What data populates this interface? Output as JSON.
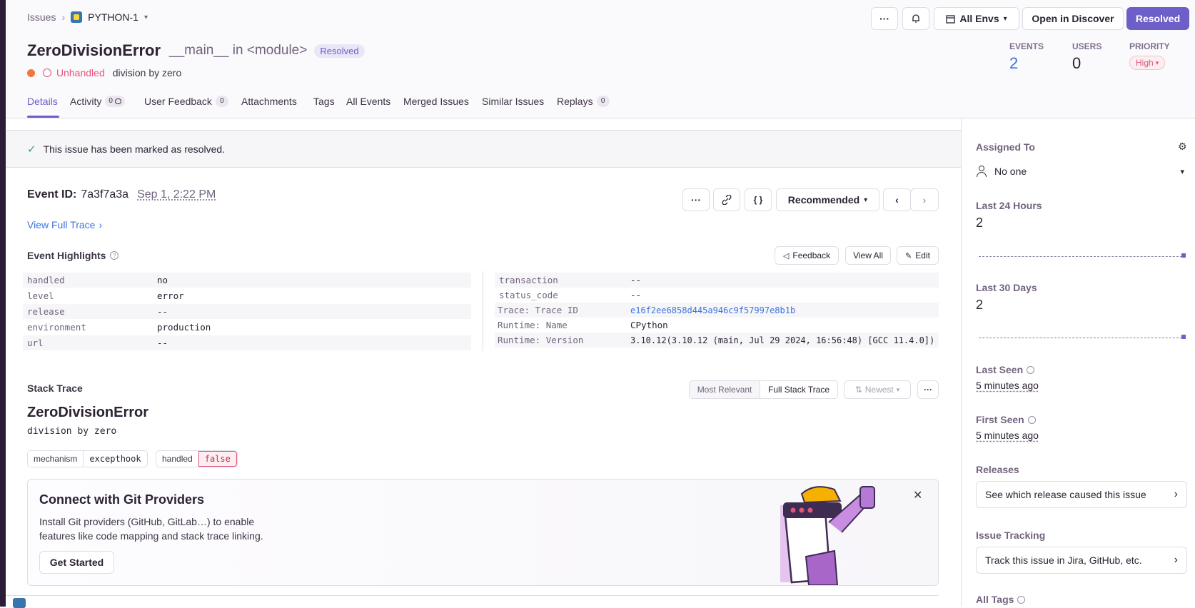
{
  "breadcrumb": {
    "issues": "Issues",
    "project": "PYTHON-1"
  },
  "header_buttons": {
    "env": "All Envs",
    "discover": "Open in Discover",
    "resolved": "Resolved"
  },
  "issue": {
    "title": "ZeroDivisionError",
    "culprit": "__main__ in <module>",
    "status_badge": "Resolved",
    "unhandled": "Unhandled",
    "message": "division by zero"
  },
  "stats": {
    "events_label": "EVENTS",
    "events": "2",
    "users_label": "USERS",
    "users": "0",
    "priority_label": "PRIORITY",
    "priority": "High"
  },
  "tabs": [
    {
      "label": "Details"
    },
    {
      "label": "Activity",
      "count": "0"
    },
    {
      "label": "User Feedback",
      "count": "0"
    },
    {
      "label": "Attachments"
    },
    {
      "label": "Tags"
    },
    {
      "label": "All Events"
    },
    {
      "label": "Merged Issues"
    },
    {
      "label": "Similar Issues"
    },
    {
      "label": "Replays",
      "count": "0"
    }
  ],
  "resolved_banner": "This issue has been marked as resolved.",
  "event": {
    "id_label": "Event ID:",
    "id": "7a3f7a3a",
    "date": "Sep 1, 2:22 PM",
    "view_trace": "View Full Trace",
    "recommended": "Recommended"
  },
  "highlights": {
    "title": "Event Highlights",
    "feedback": "Feedback",
    "view_all": "View All",
    "edit": "Edit",
    "left": [
      {
        "k": "handled",
        "v": "no"
      },
      {
        "k": "level",
        "v": "error"
      },
      {
        "k": "release",
        "v": "--"
      },
      {
        "k": "environment",
        "v": "production"
      },
      {
        "k": "url",
        "v": "--"
      }
    ],
    "right": [
      {
        "k": "transaction",
        "v": "--"
      },
      {
        "k": "status_code",
        "v": "--"
      },
      {
        "k": "Trace: Trace ID",
        "v": "e16f2ee6858d445a946c9f57997e8b1b"
      },
      {
        "k": "Runtime: Name",
        "v": "CPython"
      },
      {
        "k": "Runtime: Version",
        "v": "3.10.12(3.10.12 (main, Jul 29 2024, 16:56:48) [GCC 11.4.0])"
      }
    ]
  },
  "stack": {
    "title": "Stack Trace",
    "most_relevant": "Most Relevant",
    "full": "Full Stack Trace",
    "newest": "Newest",
    "exception": "ZeroDivisionError",
    "value": "division by zero",
    "mech_k": "mechanism",
    "mech_v": "excepthook",
    "handled_k": "handled",
    "handled_v": "false"
  },
  "git_card": {
    "title": "Connect with Git Providers",
    "body": "Install Git providers (GitHub, GitLab…) to enable features like code mapping and stack trace linking.",
    "cta": "Get Started"
  },
  "sidebar": {
    "assigned_label": "Assigned To",
    "assigned_value": "No one",
    "last24_label": "Last 24 Hours",
    "last24_value": "2",
    "last30_label": "Last 30 Days",
    "last30_value": "2",
    "last_seen_label": "Last Seen",
    "last_seen_value": "5 minutes ago",
    "first_seen_label": "First Seen",
    "first_seen_value": "5 minutes ago",
    "releases_label": "Releases",
    "releases_btn": "See which release caused this issue",
    "tracking_label": "Issue Tracking",
    "tracking_btn": "Track this issue in Jira, GitHub, etc.",
    "all_tags_label": "All Tags"
  },
  "colors": {
    "accent": "#6c5fc7",
    "error": "#e1567c",
    "link": "#3c74dd",
    "orange": "#f2763d"
  }
}
